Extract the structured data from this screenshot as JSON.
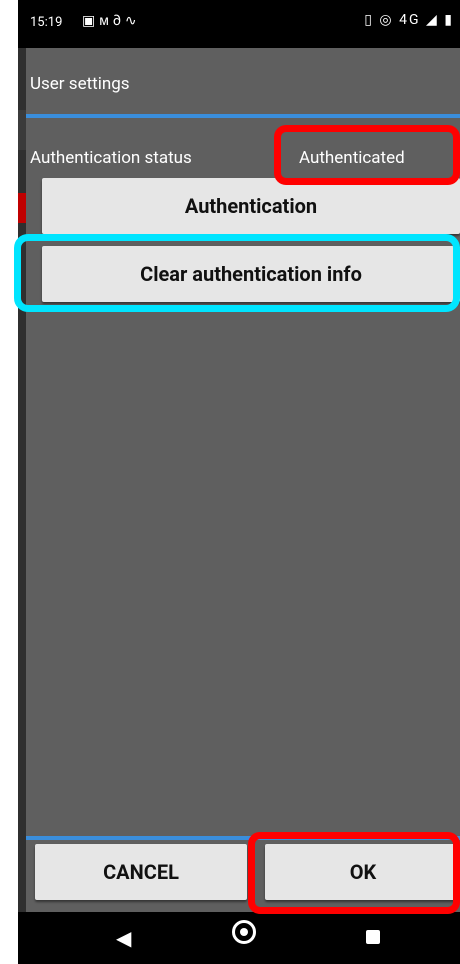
{
  "status_bar": {
    "time": "15:19",
    "left_icons": [
      "image-icon",
      "m-icon",
      "link-icon",
      "wave-icon"
    ],
    "right_icons": [
      "vibrate-icon",
      "hotspot-icon",
      "4g-icon",
      "signal-icon",
      "battery-icon"
    ],
    "network_label": "4G"
  },
  "dialog": {
    "title": "User settings",
    "auth_status_label": "Authentication status",
    "auth_status_value": "Authenticated",
    "authentication_button": "Authentication",
    "clear_button": "Clear authentication info",
    "cancel_button": "CANCEL",
    "ok_button": "OK"
  },
  "nav": {
    "back": "◀",
    "home": "home",
    "recent": "recent"
  },
  "colors": {
    "accent_line": "#3a8edc",
    "highlight_red": "#ff0000",
    "highlight_cyan": "#00e5ff",
    "dialog_bg": "#5f5f5f",
    "button_bg": "#e6e6e6"
  }
}
